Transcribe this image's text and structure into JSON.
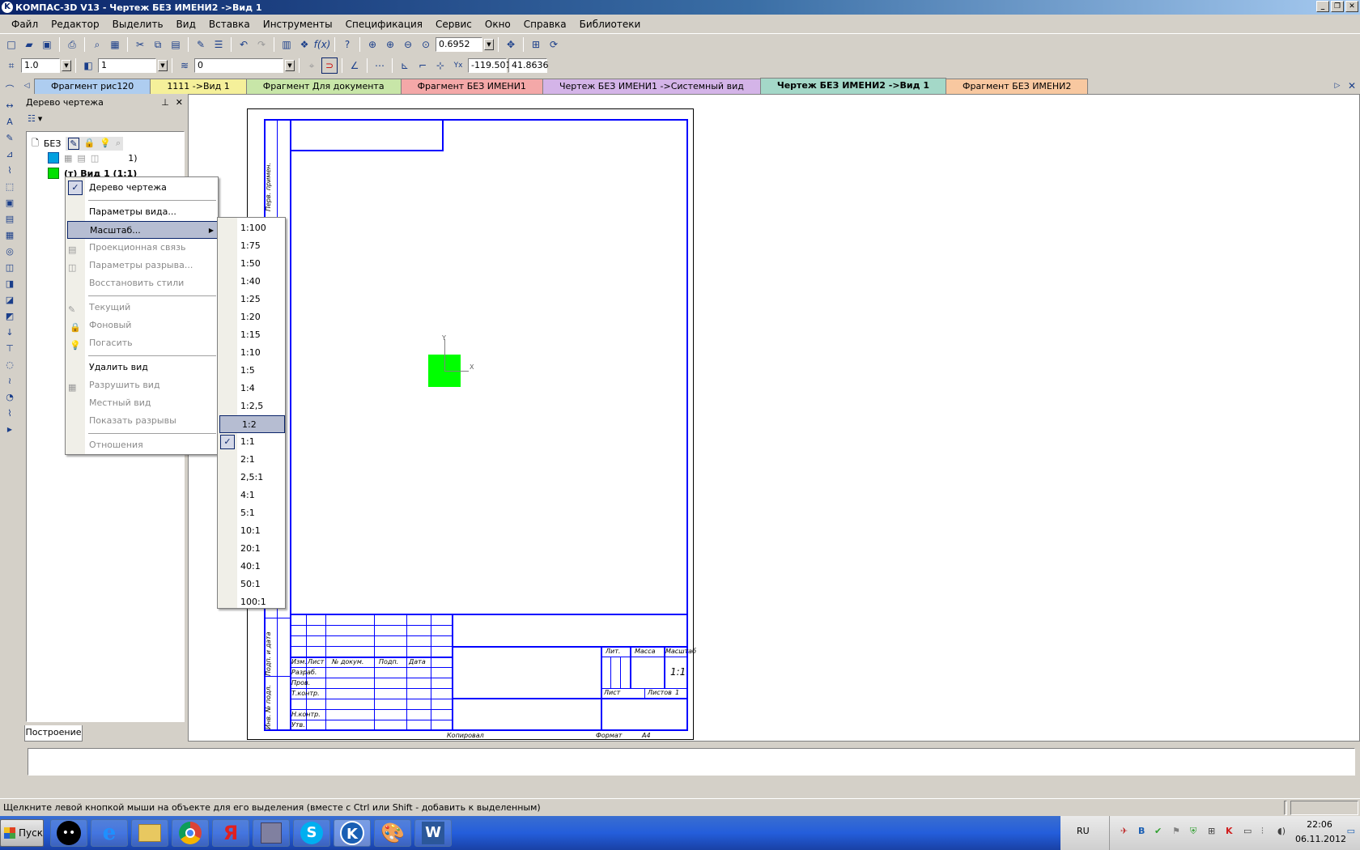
{
  "app": {
    "title": "КОМПАС-3D V13 - Чертеж БЕЗ ИМЕНИ2 ->Вид 1"
  },
  "menubar": [
    "Файл",
    "Редактор",
    "Выделить",
    "Вид",
    "Вставка",
    "Инструменты",
    "Спецификация",
    "Сервис",
    "Окно",
    "Справка",
    "Библиотеки"
  ],
  "toolbar1": {
    "zoom_value": "0.6952"
  },
  "toolbar2": {
    "line_width": "1.0",
    "view_number": "1",
    "layer": "0",
    "coord_x": "-119.501",
    "coord_y": "41.8636"
  },
  "tabs": [
    {
      "label": "Фрагмент рис120",
      "color": "#aecdf0"
    },
    {
      "label": "1111 ->Вид 1",
      "color": "#f5f09a"
    },
    {
      "label": "Фрагмент Для документа",
      "color": "#c8e6a8"
    },
    {
      "label": "Фрагмент БЕЗ ИМЕНИ1",
      "color": "#f4a8a8"
    },
    {
      "label": "Чертеж БЕЗ ИМЕНИ1 ->Системный вид",
      "color": "#d4b4e8"
    },
    {
      "label": "Чертеж БЕЗ ИМЕНИ2 ->Вид 1",
      "color": "#a4d8c8"
    },
    {
      "label": "Фрагмент БЕЗ ИМЕНИ2",
      "color": "#f8c8a0"
    }
  ],
  "tree_panel": {
    "title": "Дерево чертежа",
    "root": "БЕЗ",
    "item1_suffix": "1)",
    "item2": "(т) Вид 1 (1:1)",
    "bottom_tab": "Построение"
  },
  "context_menu": {
    "items": [
      {
        "label": "Дерево чертежа",
        "checked": true
      },
      {
        "label": "Параметры вида..."
      },
      {
        "label": "Масштаб...",
        "highlighted": true
      },
      {
        "label": "Проекционная связь",
        "disabled": true
      },
      {
        "label": "Параметры разрыва...",
        "disabled": true
      },
      {
        "label": "Восстановить стили",
        "disabled": true
      },
      {
        "label": "Текущий",
        "disabled": true
      },
      {
        "label": "Фоновый",
        "disabled": true
      },
      {
        "label": "Погасить",
        "disabled": true
      },
      {
        "label": "Удалить вид"
      },
      {
        "label": "Разрушить вид",
        "disabled": true
      },
      {
        "label": "Местный вид",
        "disabled": true
      },
      {
        "label": "Показать разрывы",
        "disabled": true
      },
      {
        "label": "Отношения",
        "disabled": true
      }
    ]
  },
  "scale_submenu": {
    "items": [
      "1:100",
      "1:75",
      "1:50",
      "1:40",
      "1:25",
      "1:20",
      "1:15",
      "1:10",
      "1:5",
      "1:4",
      "1:2,5",
      "1:2",
      "1:1",
      "2:1",
      "2,5:1",
      "4:1",
      "5:1",
      "10:1",
      "20:1",
      "40:1",
      "50:1",
      "100:1"
    ],
    "highlighted": "1:2",
    "checked": "1:1"
  },
  "drawing": {
    "side_label_top": "Перв. примен.",
    "side_label_mid": "Подп. и дата",
    "side_label_bottom": "Инв. № подл.",
    "axis_x": "X",
    "axis_y": "Y",
    "stamp": {
      "izm": "Изм.",
      "list": "Лист",
      "ndoc": "№ докум.",
      "podp": "Подп.",
      "data": "Дата",
      "razrab": "Разраб.",
      "prov": "Пров.",
      "tkontr": "Т.контр.",
      "nkontr": "Н.контр.",
      "utv": "Утв.",
      "lit": "Лит.",
      "massa": "Масса",
      "masshtab": "Масштаб",
      "scale_value": "1:1",
      "sheet": "Лист",
      "sheets": "Листов",
      "sheets_count": "1",
      "copied": "Копировал",
      "format": "Формат",
      "format_value": "A4"
    }
  },
  "status_bar": {
    "hint": "Щелкните левой кнопкой мыши на объекте для его выделения (вместе с Ctrl или Shift - добавить к выделенным)"
  },
  "taskbar": {
    "start": "Пуск",
    "lang": "RU",
    "time": "22:06",
    "date": "06.11.2012"
  },
  "colors": {
    "accent": "#0a246a",
    "drawing_line": "#0000ff",
    "view_origin": "#00ff00"
  }
}
